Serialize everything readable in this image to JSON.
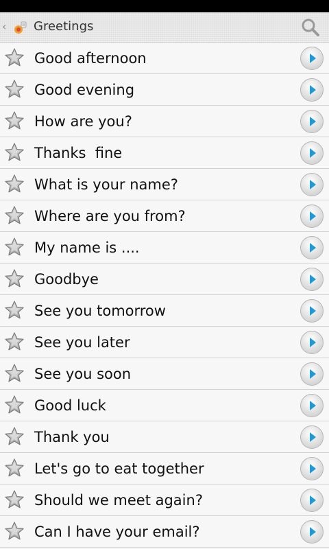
{
  "header": {
    "title": "Greetings"
  },
  "phrases": [
    "Good afternoon",
    "Good evening",
    "How are you?",
    "Thanks  fine",
    "What is your name?",
    "Where are you from?",
    "My name is ....",
    "Goodbye",
    "See you tomorrow",
    "See you later",
    "See you soon",
    "Good luck",
    "Thank you",
    "Let's go to eat together",
    "Should we meet again?",
    "Can I have your email?"
  ],
  "colors": {
    "play_arrow": "#1e9ad6",
    "star_fill": "#b8b8b8"
  }
}
